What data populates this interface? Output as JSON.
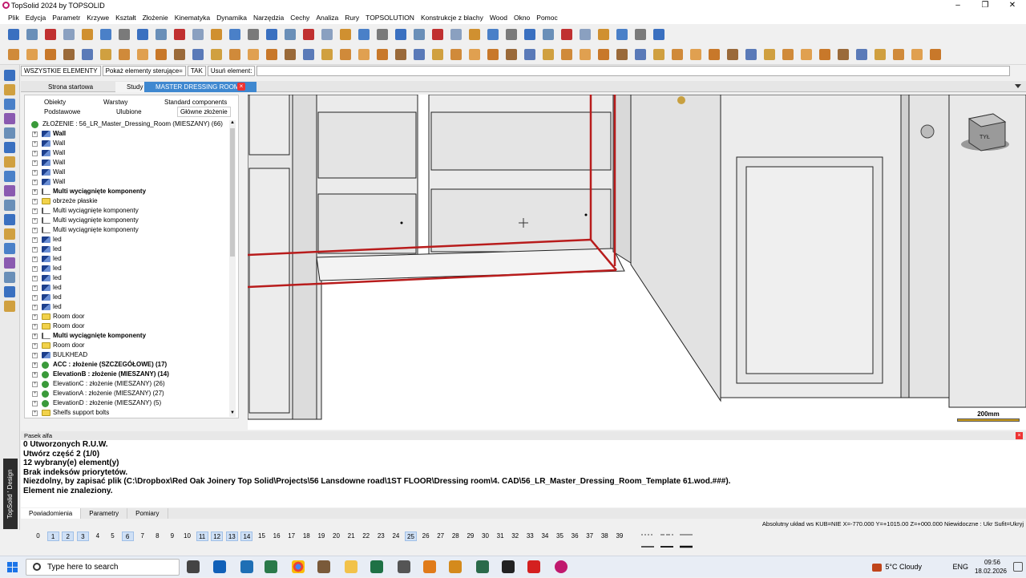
{
  "window": {
    "title": "TopSolid 2024 by TOPSOLID",
    "controls": [
      "–",
      "❐",
      "✕"
    ]
  },
  "menu": [
    "Plik",
    "Edycja",
    "Parametr",
    "Krzywe",
    "Kształt",
    "Złożenie",
    "Kinematyka",
    "Dynamika",
    "Narzędzia",
    "Cechy",
    "Analiza",
    "Rury",
    "TOPSOLUTION",
    "Konstrukcje z blachy",
    "Wood",
    "Okno",
    "Pomoc"
  ],
  "cmdbar": {
    "filter": "WSZYSTKIE ELEMENTY",
    "show_ctrl": "Pokaż elementy sterujące=",
    "show_ctrl_value": "TAK",
    "remove": "Usuń element:"
  },
  "doctabs": [
    {
      "label": "Strona startowa"
    },
    {
      "label": "Study"
    },
    {
      "label": "MASTER DRESSING ROOM *"
    }
  ],
  "panel_tabs": {
    "row1": [
      "Obiekty",
      "Warstwy",
      "Standard components"
    ],
    "row2": [
      "Podstawowe",
      "Ulubione",
      "Główne złożenie"
    ]
  },
  "tree": {
    "root": "ZŁOŻENIE : 56_LR_Master_Dressing_Room (MIESZANY) (66)",
    "items": [
      {
        "icon": "wall",
        "label": "Wall",
        "bold": true
      },
      {
        "icon": "wall",
        "label": "Wall",
        "bold": false
      },
      {
        "icon": "wall",
        "label": "Wall",
        "bold": false
      },
      {
        "icon": "wall",
        "label": "Wall",
        "bold": false
      },
      {
        "icon": "wall",
        "label": "Wall",
        "bold": false
      },
      {
        "icon": "wall",
        "label": "Wall",
        "bold": false
      },
      {
        "icon": "multi",
        "label": "Multi wyciągnięte komponenty",
        "bold": true
      },
      {
        "icon": "folder",
        "label": "obrzeże płaskie",
        "bold": false
      },
      {
        "icon": "multi",
        "label": "Multi wyciągnięte komponenty",
        "bold": false
      },
      {
        "icon": "multi",
        "label": "Multi wyciągnięte komponenty",
        "bold": false
      },
      {
        "icon": "multi",
        "label": "Multi wyciągnięte komponenty",
        "bold": false
      },
      {
        "icon": "led",
        "label": "led",
        "bold": false
      },
      {
        "icon": "led",
        "label": "led",
        "bold": false
      },
      {
        "icon": "led",
        "label": "led",
        "bold": false
      },
      {
        "icon": "led",
        "label": "led",
        "bold": false
      },
      {
        "icon": "led",
        "label": "led",
        "bold": false
      },
      {
        "icon": "led",
        "label": "led",
        "bold": false
      },
      {
        "icon": "led",
        "label": "led",
        "bold": false
      },
      {
        "icon": "led",
        "label": "led",
        "bold": false
      },
      {
        "icon": "folder",
        "label": "Room door",
        "bold": false
      },
      {
        "icon": "folder",
        "label": "Room door",
        "bold": false
      },
      {
        "icon": "multi",
        "label": "Multi wyciągnięte komponenty",
        "bold": true
      },
      {
        "icon": "folder",
        "label": "Room door",
        "bold": false
      },
      {
        "icon": "wall",
        "label": "BULKHEAD",
        "bold": false
      },
      {
        "icon": "asm",
        "label": "ACC : złożenie (SZCZEGÓŁOWE) (17)",
        "bold": true
      },
      {
        "icon": "asm",
        "label": "ElevationB : złożenie (MIESZANY) (14)",
        "bold": true
      },
      {
        "icon": "asm",
        "label": "ElevationC : złożenie (MIESZANY) (26)",
        "bold": false
      },
      {
        "icon": "asm",
        "label": "ElevationA : złożenie (MIESZANY) (27)",
        "bold": false
      },
      {
        "icon": "asm",
        "label": "ElevationD : złożenie (MIESZANY) (5)",
        "bold": false
      },
      {
        "icon": "folder",
        "label": "Shelfs support bolts",
        "bold": false
      }
    ]
  },
  "viewport": {
    "scale_label": "200mm",
    "cube_label": "TYŁ"
  },
  "alfa": {
    "header": "Pasek alfa",
    "lines": [
      "0 Utworzonych R.U.W.",
      "Utwórz część 2 (1/0)",
      "12 wybrany(e) element(y)",
      "Brak indeksów priorytetów.",
      "Niezdolny, by zapisać plik (C:\\Dropbox\\Red Oak Joinery Top Solid\\Projects\\56 Lansdowne road\\1ST FLOOR\\Dressing room\\4. CAD\\56_LR_Master_Dressing_Room_Template 61.wod.###).",
      "Element nie znaleziony."
    ]
  },
  "bottom_tabs": [
    "Powiadomienia",
    "Parametry",
    "Pomiary"
  ],
  "status": "Absolutny układ ws KUB=NIE  X=-770.000  Y=+1015.00  Z=+000.000  Niewidoczne : Ukr  Sufit=Ukryj",
  "layers": [
    "0",
    "1",
    "2",
    "3",
    "4",
    "5",
    "6",
    "7",
    "8",
    "9",
    "10",
    "11",
    "12",
    "13",
    "14",
    "15",
    "16",
    "17",
    "18",
    "19",
    "20",
    "21",
    "22",
    "23",
    "24",
    "25",
    "26",
    "27",
    "28",
    "29",
    "30",
    "31",
    "32",
    "33",
    "34",
    "35",
    "36",
    "37",
    "38",
    "39"
  ],
  "selected_layers": [
    "1",
    "2",
    "3",
    "6",
    "11",
    "12",
    "13",
    "14",
    "25"
  ],
  "taskbar": {
    "search": "Type here to search",
    "weather": "5°C  Cloudy",
    "lang": "ENG",
    "time": "09:56",
    "date": "18.02.2026"
  }
}
